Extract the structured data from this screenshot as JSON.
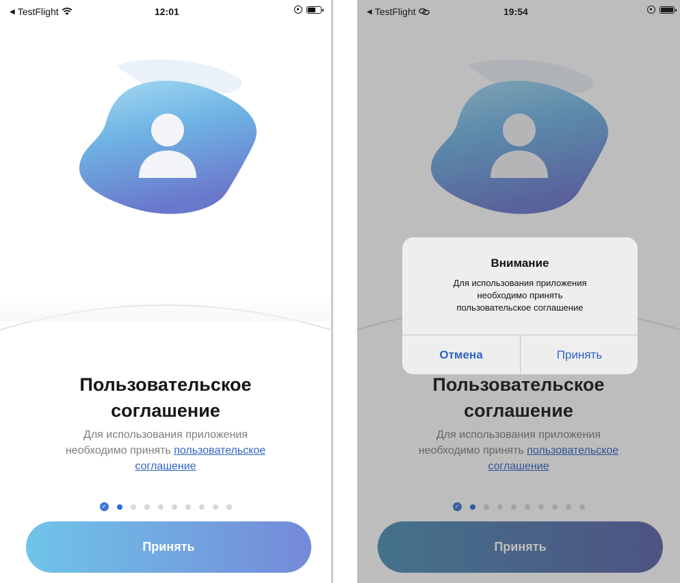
{
  "left_screen": {
    "status": {
      "back_label": "TestFlight",
      "time": "12:01",
      "wifi_icon": "wifi-icon",
      "battery_icon": "battery-icon"
    },
    "title_line1": "Пользовательское",
    "title_line2": "соглашение",
    "desc_line1": "Для использования приложения",
    "desc_line2_prefix": "необходимо принять",
    "desc_link_part1": "пользовательское",
    "desc_link_part2": "соглашение",
    "pager": {
      "total": 10,
      "current": 2
    },
    "accept_label": "Принять",
    "accept_gradient": [
      "#6fc4e9",
      "#748ad8"
    ]
  },
  "right_screen": {
    "status": {
      "back_label": "TestFlight",
      "time": "19:54",
      "signal_icon": "link-icon",
      "battery_icon": "battery-icon"
    },
    "title_line1": "Пользовательское",
    "title_line2": "соглашение",
    "desc_line1": "Для использования приложения",
    "desc_line2_prefix": "необходимо принять",
    "desc_link_part1": "пользовательское",
    "desc_link_part2": "соглашение",
    "pager": {
      "total": 10,
      "current": 2
    },
    "accept_label": "Принять",
    "accept_gradient": [
      "#4b8fb5",
      "#5a63a8"
    ],
    "alert": {
      "title": "Внимание",
      "msg_line1": "Для использования приложения",
      "msg_line2": "необходимо принять",
      "msg_line3": "пользовательское соглашение",
      "cancel_label": "Отмена",
      "accept_label": "Принять"
    }
  },
  "colors": {
    "link": "#2f63c5",
    "hero_light": "#9dd2ef",
    "hero_dark": "#6b7fcf"
  }
}
